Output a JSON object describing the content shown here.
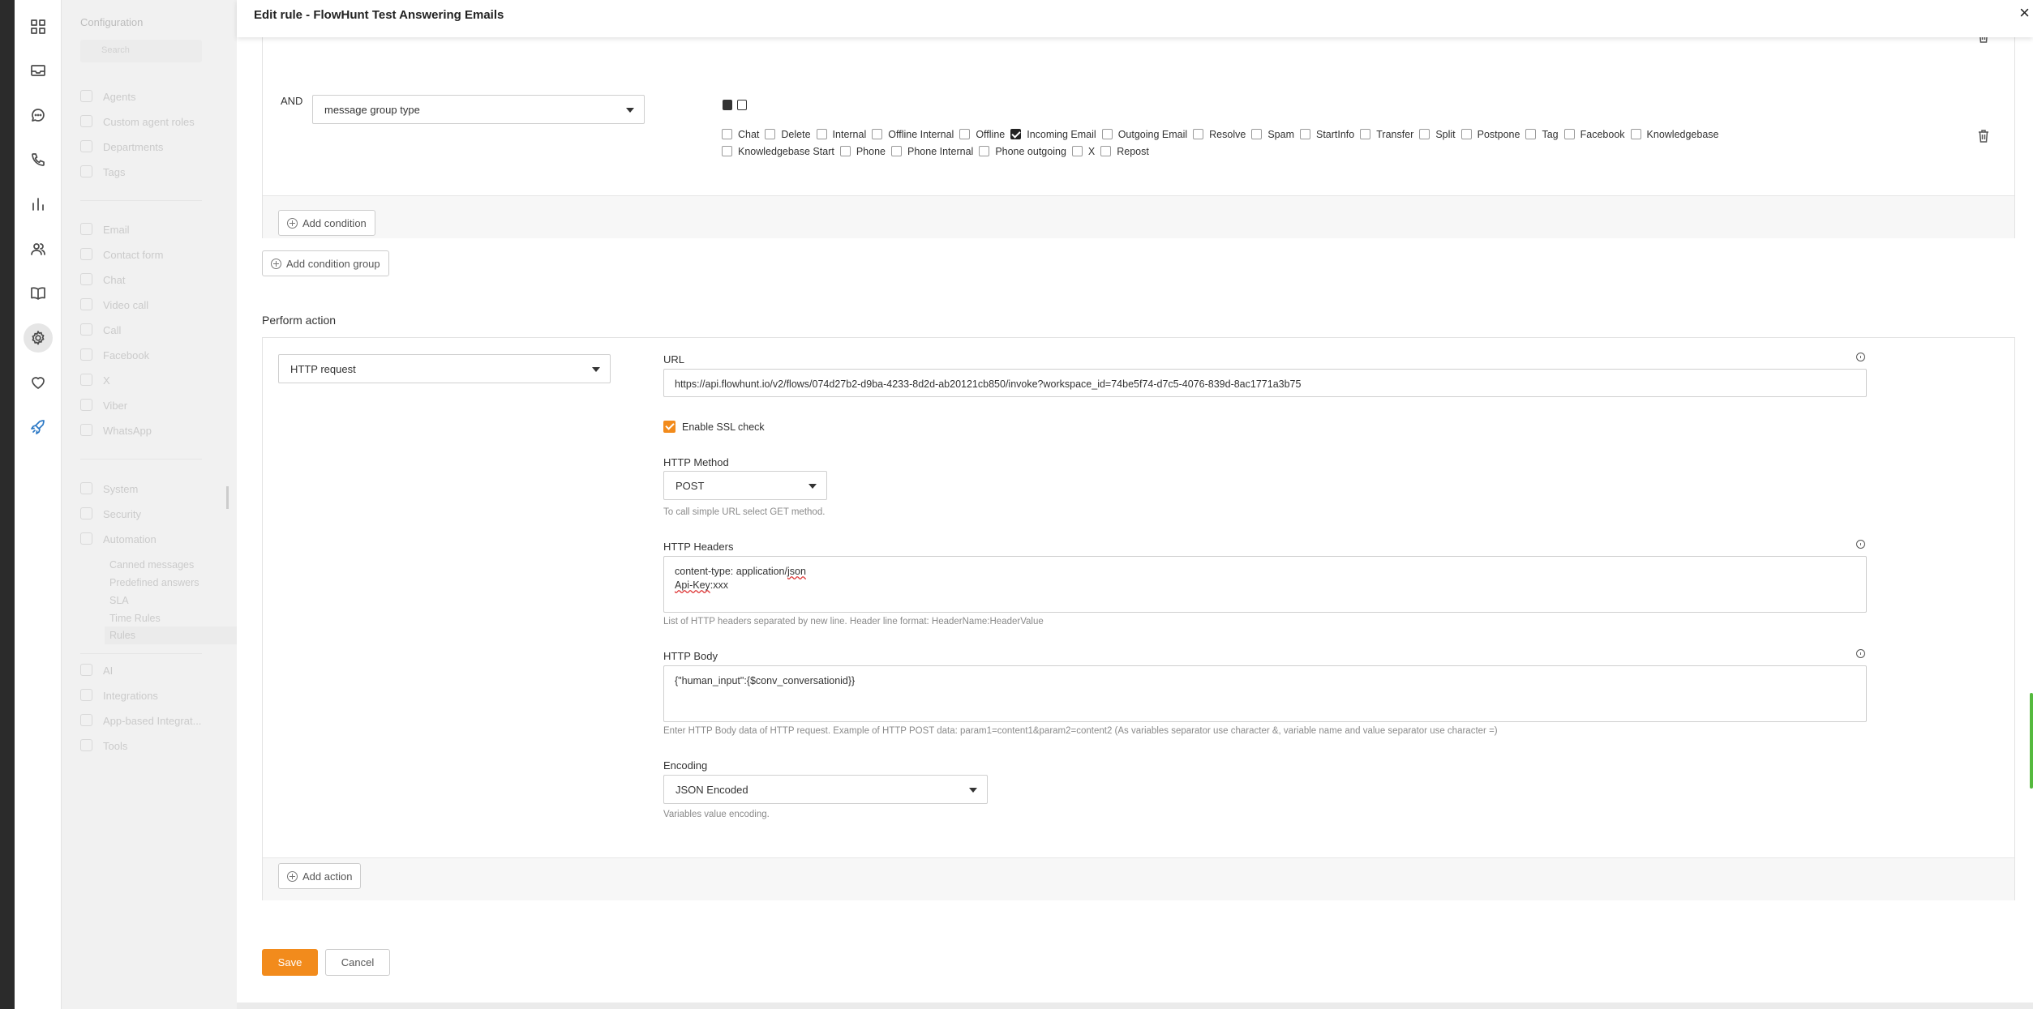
{
  "sidebar": {
    "heading": "Configuration",
    "search_placeholder": "Search",
    "group1": [
      "Agents",
      "Custom agent roles",
      "Departments",
      "Tags"
    ],
    "group2": [
      "Email",
      "Contact form",
      "Chat",
      "Video call",
      "Call",
      "Facebook",
      "X",
      "Viber",
      "WhatsApp"
    ],
    "group3": [
      "System",
      "Security",
      "Automation"
    ],
    "automation_sub": [
      "Canned messages",
      "Predefined answers",
      "SLA",
      "Time Rules",
      "Rules"
    ],
    "group4": [
      "AI",
      "Integrations",
      "App-based Integrat...",
      "Tools"
    ]
  },
  "rail_icons": [
    "dashboard-icon",
    "mail-icon",
    "chat-icon",
    "phone-icon",
    "reports-icon",
    "contacts-icon",
    "knowledgebase-icon",
    "settings-icon",
    "heart-icon",
    "rocket-icon"
  ],
  "modal": {
    "title": "Edit rule - FlowHunt Test Answering Emails",
    "close": "×"
  },
  "conditions": {
    "operator": "AND",
    "field_value": "message group type",
    "options": [
      {
        "label": "Chat",
        "checked": false
      },
      {
        "label": "Delete",
        "checked": false
      },
      {
        "label": "Internal",
        "checked": false
      },
      {
        "label": "Offline Internal",
        "checked": false
      },
      {
        "label": "Offline",
        "checked": false
      },
      {
        "label": "Incoming Email",
        "checked": true
      },
      {
        "label": "Outgoing Email",
        "checked": false
      },
      {
        "label": "Resolve",
        "checked": false
      },
      {
        "label": "Spam",
        "checked": false
      },
      {
        "label": "StartInfo",
        "checked": false
      },
      {
        "label": "Transfer",
        "checked": false
      },
      {
        "label": "Split",
        "checked": false
      },
      {
        "label": "Postpone",
        "checked": false
      },
      {
        "label": "Tag",
        "checked": false
      },
      {
        "label": "Facebook",
        "checked": false
      },
      {
        "label": "Knowledgebase",
        "checked": false
      }
    ],
    "options_row2": [
      {
        "label": "Knowledgebase Start",
        "checked": false
      },
      {
        "label": "Phone",
        "checked": false
      },
      {
        "label": "Phone Internal",
        "checked": false
      },
      {
        "label": "Phone outgoing",
        "checked": false
      },
      {
        "label": "X",
        "checked": false
      },
      {
        "label": "Repost",
        "checked": false
      }
    ],
    "add_condition": "Add condition",
    "add_condition_group": "Add condition group"
  },
  "action": {
    "section_title": "Perform action",
    "type_value": "HTTP request",
    "url_label": "URL",
    "url_value": "https://api.flowhunt.io/v2/flows/074d27b2-d9ba-4233-8d2d-ab20121cb850/invoke?workspace_id=74be5f74-d7c5-4076-839d-8ac1771a3b75",
    "ssl_label": "Enable SSL check",
    "ssl_checked": true,
    "method_label": "HTTP Method",
    "method_value": "POST",
    "method_hint": "To call simple URL select GET method.",
    "headers_label": "HTTP Headers",
    "headers_line1_prefix": "content-type: application/",
    "headers_line1_word": "json",
    "headers_line2_word": "Api-Key",
    "headers_line2_suffix": ":xxx",
    "headers_hint": "List of HTTP headers separated by new line. Header line format: HeaderName:HeaderValue",
    "body_label": "HTTP Body",
    "body_value": "{\"human_input\":{$conv_conversationid}}",
    "body_hint": "Enter HTTP Body data of HTTP request. Example of HTTP POST data: param1=content1&param2=content2 (As variables separator use character &, variable name and value separator use character =)",
    "encoding_label": "Encoding",
    "encoding_value": "JSON Encoded",
    "encoding_hint": "Variables value encoding.",
    "add_action": "Add action"
  },
  "buttons": {
    "save": "Save",
    "cancel": "Cancel"
  },
  "colors": {
    "accent": "#f28b1c",
    "checkbox_checked": "#222222"
  }
}
